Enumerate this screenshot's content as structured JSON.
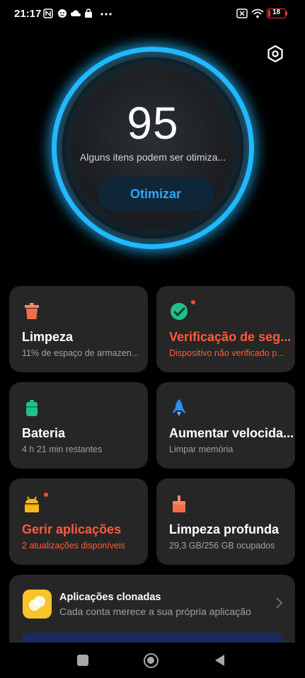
{
  "status_bar": {
    "time": "21:17",
    "battery_level": "18"
  },
  "score": {
    "value": "95",
    "description": "Alguns itens podem ser otimiza...",
    "button_label": "Otimizar"
  },
  "cards": {
    "limpeza": {
      "title": "Limpeza",
      "subtitle": "11% de espaço de armazen..."
    },
    "seguranca": {
      "title": "Verificação de seg...",
      "subtitle": "Dispositivo não verificado p..."
    },
    "bateria": {
      "title": "Bateria",
      "subtitle": "4 h 21 min  restantes"
    },
    "velocidade": {
      "title": "Aumentar velocida...",
      "subtitle": "Limpar memória"
    },
    "aplicacoes": {
      "title": "Gerir aplicações",
      "subtitle": "2 atualizações disponíveis"
    },
    "profunda": {
      "title": "Limpeza profunda",
      "subtitle": "29,3 GB/256 GB ocupados"
    }
  },
  "clone": {
    "title": "Aplicações clonadas",
    "subtitle": "Cada conta merece a sua própria aplicação"
  },
  "colors": {
    "accent": "#22b8ff",
    "warning": "#ff5a3c",
    "card_bg": "#262626"
  },
  "icons": {
    "settings": "hexagon-gear-icon",
    "limpeza": "trash-icon",
    "seguranca": "shield-check-icon",
    "bateria": "battery-icon",
    "velocidade": "rocket-icon",
    "aplicacoes": "android-box-icon",
    "profunda": "brush-icon",
    "clone": "clone-app-icon"
  }
}
